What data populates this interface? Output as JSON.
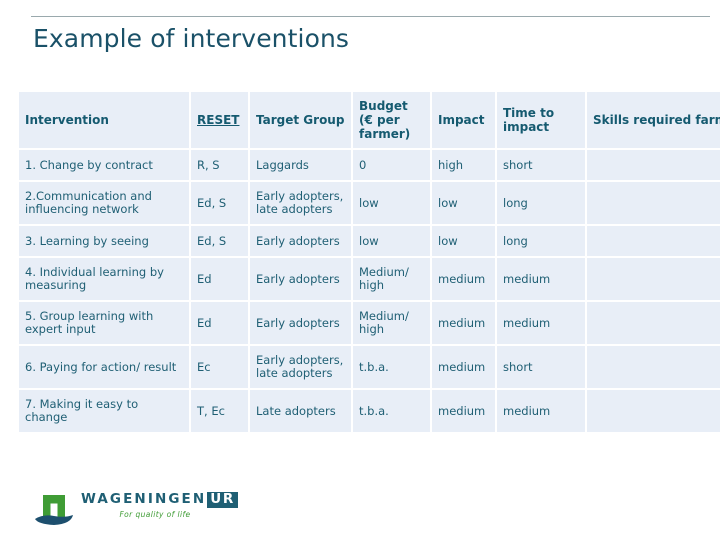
{
  "slide": {
    "title": "Example of interventions"
  },
  "table": {
    "headers": {
      "intervention": "Intervention",
      "reset": "RESET",
      "target_group": "Target Group",
      "budget": "Budget (€ per farmer)",
      "impact": "Impact",
      "time_to_impact": "Time to impact",
      "skills_required": "Skills required farmer - processor"
    },
    "rows": [
      {
        "intervention": "1. Change by contract",
        "reset": "R, S",
        "target_group": "Laggards",
        "budget": "0",
        "impact": "high",
        "time_to_impact": "short",
        "skills_required": "",
        "size": "short"
      },
      {
        "intervention": "2.Communication and influencing network",
        "reset": "Ed, S",
        "target_group": "Early adopters, late adopters",
        "budget": "low",
        "impact": "low",
        "time_to_impact": "long",
        "skills_required": "",
        "size": "tall"
      },
      {
        "intervention": "3. Learning by seeing",
        "reset": "Ed, S",
        "target_group": "Early adopters",
        "budget": "low",
        "impact": "low",
        "time_to_impact": "long",
        "skills_required": "",
        "size": "short"
      },
      {
        "intervention": "4. Individual learning by measuring",
        "reset": "Ed",
        "target_group": "Early adopters",
        "budget": "Medium/ high",
        "impact": "medium",
        "time_to_impact": "medium",
        "skills_required": "",
        "size": "tall"
      },
      {
        "intervention": "5. Group learning with expert input",
        "reset": "Ed",
        "target_group": "Early adopters",
        "budget": "Medium/ high",
        "impact": "medium",
        "time_to_impact": "medium",
        "skills_required": "",
        "size": "tall"
      },
      {
        "intervention": "6. Paying for action/ result",
        "reset": "Ec",
        "target_group": "Early adopters, late adopters",
        "budget": "t.b.a.",
        "impact": "medium",
        "time_to_impact": "short",
        "skills_required": "",
        "size": "tall"
      },
      {
        "intervention": "7. Making it easy to change",
        "reset": "T, Ec",
        "target_group": "Late adopters",
        "budget": "t.b.a.",
        "impact": "medium",
        "time_to_impact": "medium",
        "skills_required": "",
        "size": "tall"
      }
    ]
  },
  "logo": {
    "wordmark": "WAGENINGEN",
    "badge": "UR",
    "tagline": "For quality of life"
  },
  "colors": {
    "title": "#1a5168",
    "cell_bg": "#e8eef7",
    "text": "#1f5f74",
    "rule": "#9aa9ad",
    "logo_green": "#3f9c35",
    "logo_blue": "#1d4f6e"
  }
}
